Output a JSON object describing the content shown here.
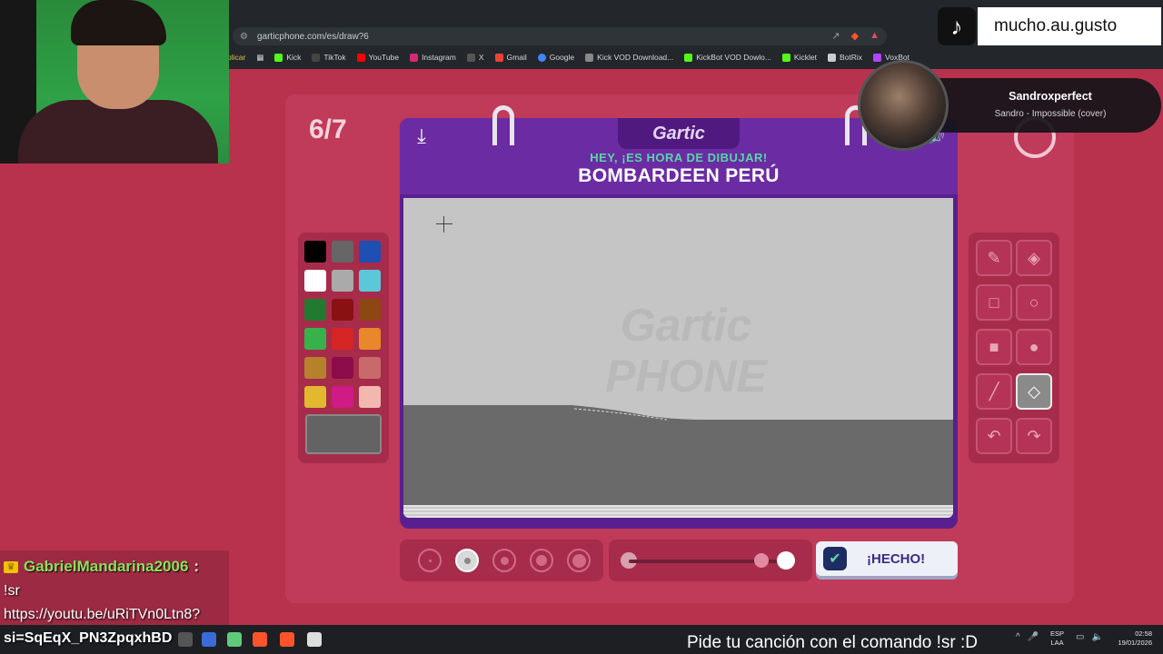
{
  "browser": {
    "url": "garticphone.com/es/draw?6",
    "bookmarks": [
      {
        "label": "Kick",
        "color": "#53fc18"
      },
      {
        "label": "TikTok",
        "color": "#111111"
      },
      {
        "label": "YouTube",
        "color": "#ff0000"
      },
      {
        "label": "Instagram",
        "color": "#d62976"
      },
      {
        "label": "X",
        "color": "#000000"
      },
      {
        "label": "Gmail",
        "color": "#ea4335"
      },
      {
        "label": "Google",
        "color": "#4285f4"
      },
      {
        "label": "Kick VOD Download...",
        "color": "#53fc18"
      },
      {
        "label": "KickBot VOD Dowlo...",
        "color": "#53fc18"
      },
      {
        "label": "Kicklet",
        "color": "#53fc18"
      },
      {
        "label": "BotRix",
        "color": "#9c4cff"
      },
      {
        "label": "VoxBot",
        "color": "#b044ff"
      }
    ],
    "apps_label": "olicar"
  },
  "game": {
    "round": "6/7",
    "logo": "Gartic",
    "prompt_sub": "HEY, ¡ES HORA DE DIBUJAR!",
    "prompt_main": "BOMBARDEEN PERÚ",
    "watermark": "Gartic PHONE",
    "done_label": "¡HECHO!",
    "colors": [
      "#000000",
      "#666666",
      "#1f4fb3",
      "#ffffff",
      "#aaaaaa",
      "#5bc8d9",
      "#217a2f",
      "#8a1111",
      "#8c4712",
      "#37b24a",
      "#d52525",
      "#e8882a",
      "#b5812a",
      "#8c0d4a",
      "#c86a6a",
      "#e2b82e",
      "#d01a86",
      "#f2b8b0"
    ],
    "custom_color": "#636363",
    "tools": [
      "pencil-icon",
      "eraser-icon",
      "rectangle-outline-icon",
      "circle-outline-icon",
      "rectangle-filled-icon",
      "circle-filled-icon",
      "line-icon",
      "fill-bucket-icon",
      "undo-icon",
      "redo-icon"
    ],
    "active_tool": "fill-bucket-icon",
    "brush_sizes": 5,
    "selected_brush_size": 2,
    "opacity_level": 1.0
  },
  "overlay": {
    "tiktok_handle": "mucho.au.gusto",
    "now_playing_user": "Sandroxperfect",
    "now_playing_song": "Sandro - Impossible (cover)",
    "chat_user": "GabrielMandarina2006",
    "chat_colon": ":",
    "chat_line1": "!sr",
    "chat_line2": "https://youtu.be/uRiTVn0Ltn8?",
    "chat_line3": "si=SqEqX_PN3ZpqxhBD"
  },
  "taskbar": {
    "ticker": "Pide tu canción con el comando !sr :D",
    "lang_top": "ESP",
    "lang_bottom": "LAA",
    "time": "02:58",
    "date": "19/01/2026"
  }
}
